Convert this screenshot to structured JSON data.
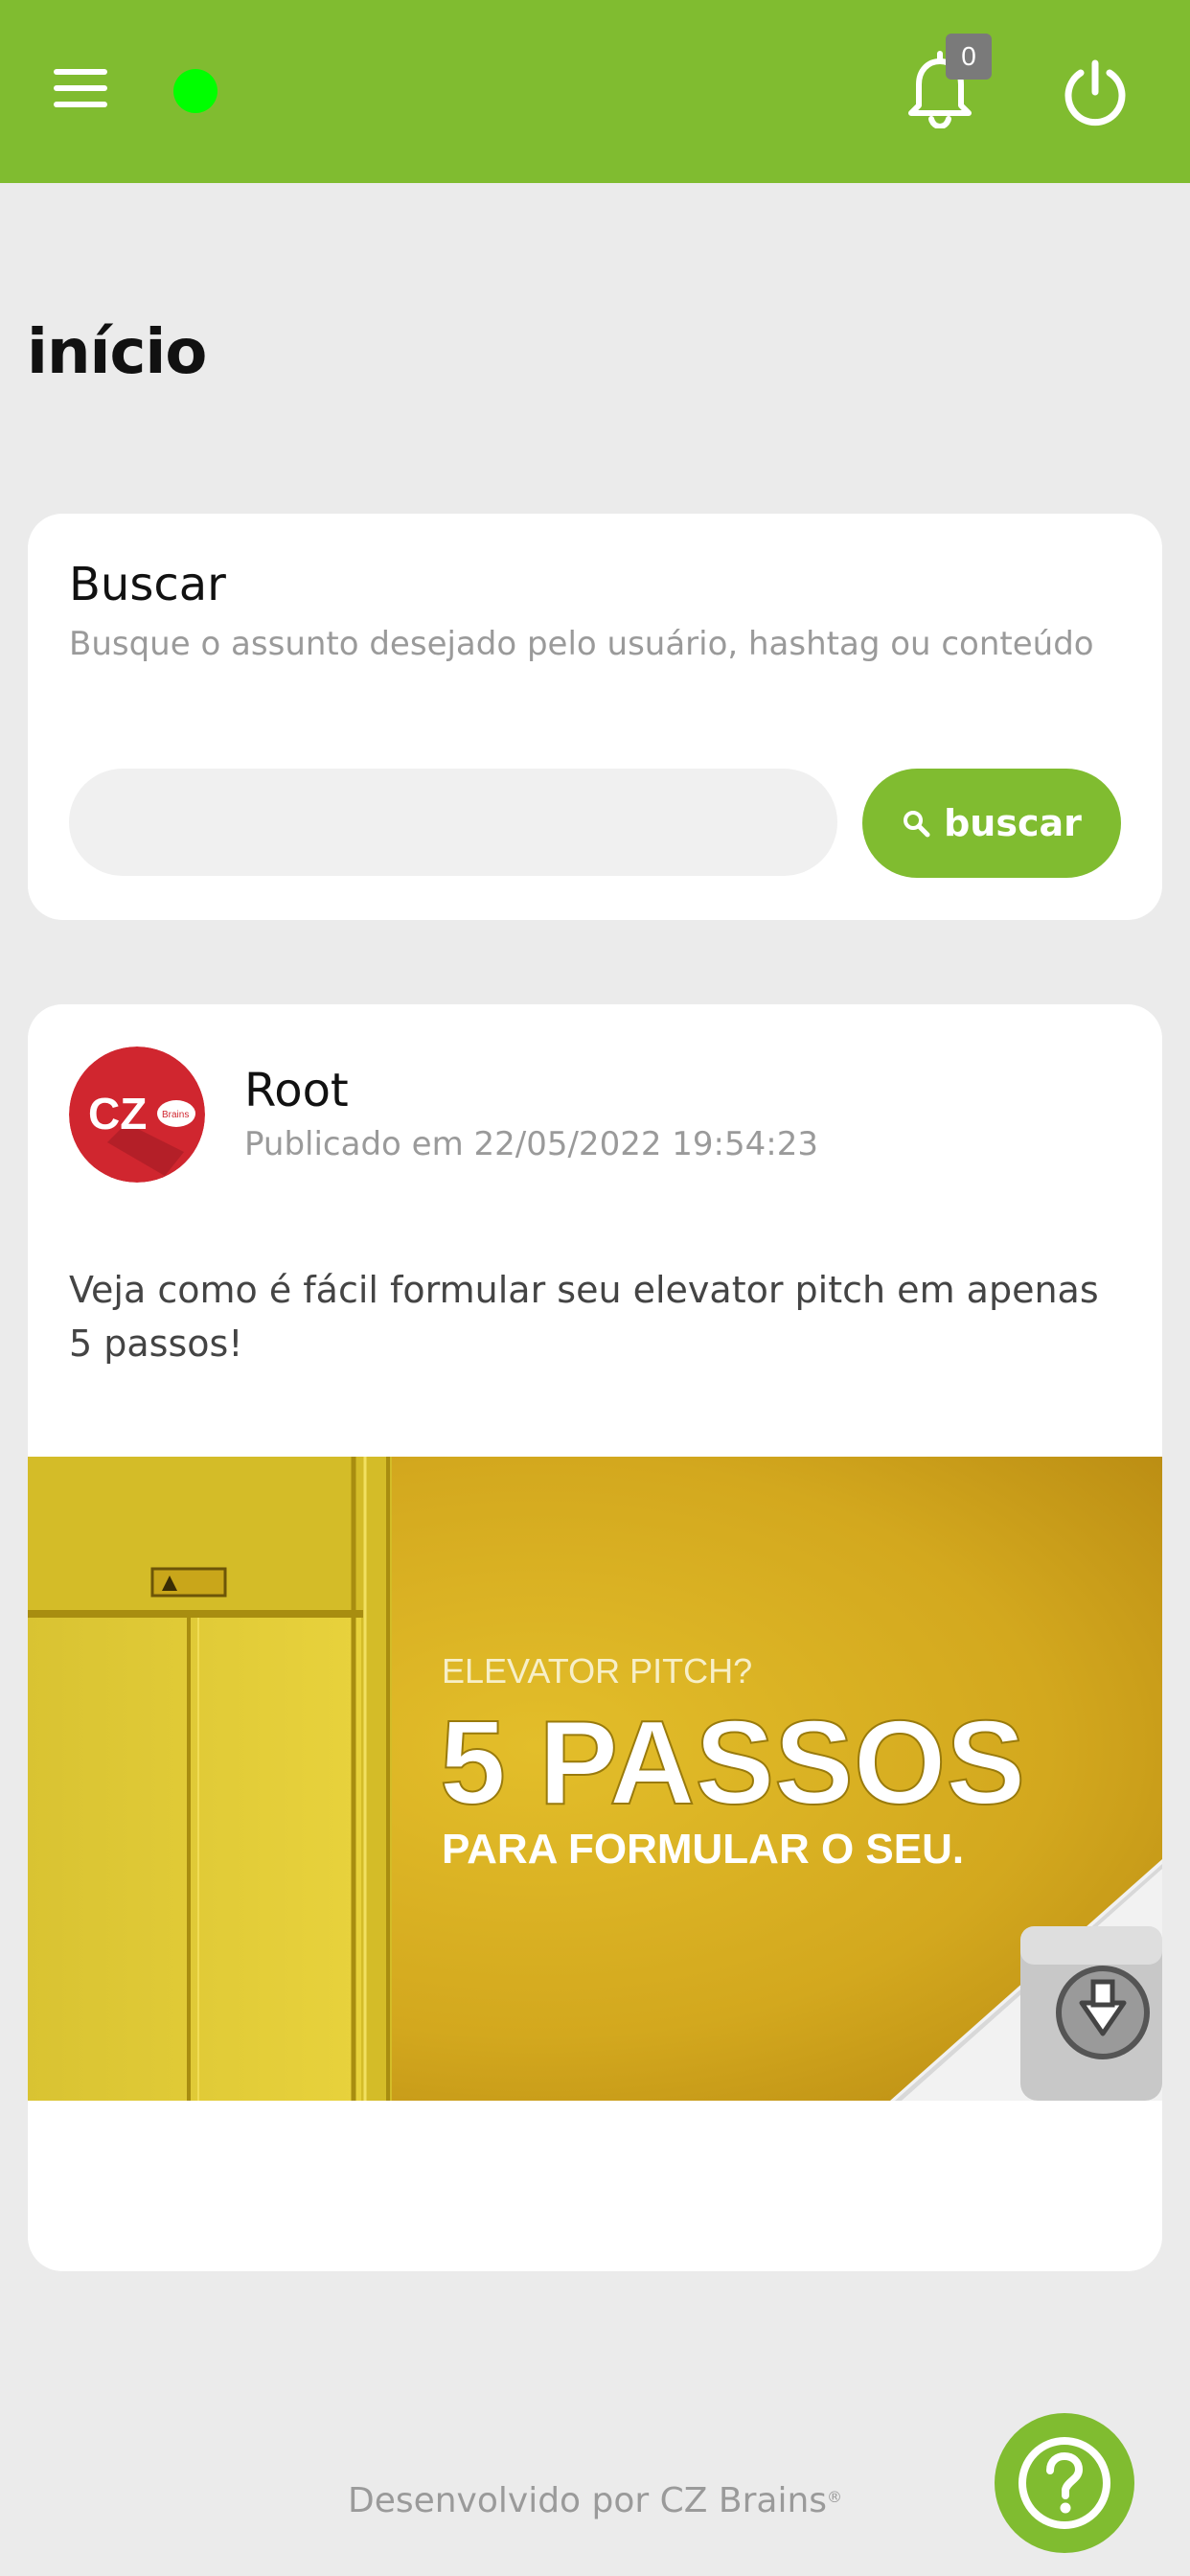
{
  "header": {
    "menu_icon": "hamburger-menu-icon",
    "status_icon": "online-status-dot",
    "status_color": "#00ff00",
    "notification_icon": "bell-icon",
    "notification_count": "0",
    "power_icon": "power-icon",
    "accent_color": "#80bc30"
  },
  "page": {
    "title": "início"
  },
  "search": {
    "title": "Buscar",
    "description": "Busque o assunto desejado pelo usuário, hashtag ou conteúdo",
    "input_value": "",
    "input_placeholder": "",
    "button_icon": "search-icon",
    "button_label": "buscar"
  },
  "post": {
    "author": "Root",
    "date": "Publicado em 22/05/2022 19:54:23",
    "text": "Veja como é fácil formular seu elevator pitch em apenas 5 passos!",
    "avatar_logo_text": "CZ",
    "avatar_logo_subtext": "Brains",
    "image": {
      "line1": "ELEVATOR PITCH?",
      "line2": "5 PASSOS",
      "line3": "PARA FORMULAR O SEU."
    }
  },
  "footer": {
    "text": "Desenvolvido por CZ Brains",
    "registered_mark": "®",
    "help_icon": "help-question-icon"
  }
}
